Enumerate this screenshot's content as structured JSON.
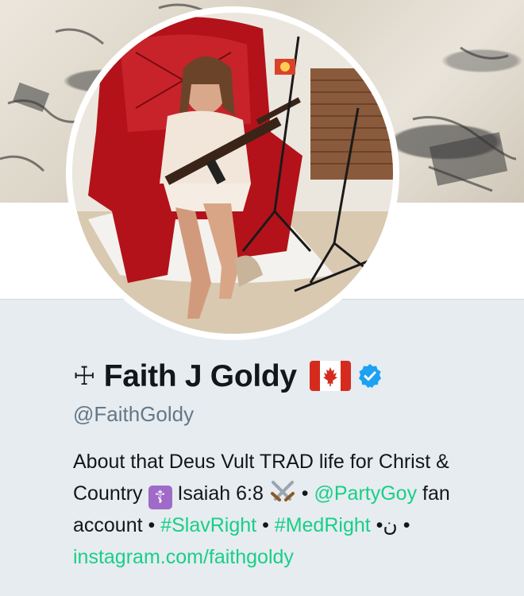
{
  "profile": {
    "name_prefix": "☩",
    "name": "Faith J Goldy",
    "flag": "Canada",
    "verified": true,
    "handle": "@FaithGoldy",
    "bio": {
      "t1": "About that Deus Vult TRAD life for Christ & Country",
      "emoji_cross": "☦",
      "t2": "Isaiah 6:8",
      "t3": "•",
      "link1": "@PartyGoy",
      "t4": "fan account •",
      "link2": "#SlavRight",
      "t5": "•",
      "link3": "#MedRight",
      "t6": "•ن •",
      "link4": "instagram.com/faithgoldy"
    }
  },
  "colors": {
    "link": "#19cf86",
    "text": "#14171a",
    "muted": "#657786",
    "background": "#e6ecf0",
    "verified": "#1da1f2"
  },
  "icons": {
    "flag": "canada-flag-icon",
    "verified": "verified-badge-icon",
    "swords": "crossed-swords-icon"
  }
}
